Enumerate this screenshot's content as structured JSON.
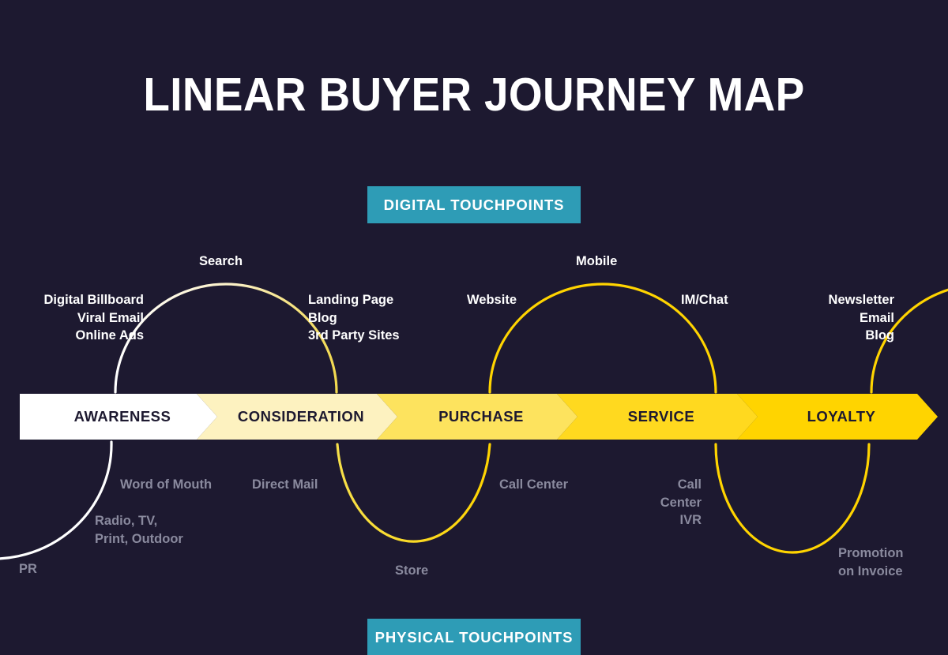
{
  "title": "LINEAR BUYER JOURNEY MAP",
  "colors": {
    "background": "#1d1930",
    "badge": "#2e9cb6",
    "digital_text": "#ffffff",
    "physical_text": "#8a8a9e",
    "arc_white": "#ffffff",
    "arc_cream": "#f6edc0",
    "arc_yellow": "#ffd400",
    "stage_text": "#1d1930"
  },
  "badges": {
    "digital": "DIGITAL TOUCHPOINTS",
    "physical": "PHYSICAL TOUCHPOINTS"
  },
  "stages": [
    {
      "label": "AWARENESS",
      "fill": "#ffffff"
    },
    {
      "label": "CONSIDERATION",
      "fill": "#fdf2c0"
    },
    {
      "label": "PURCHASE",
      "fill": "#fde35e"
    },
    {
      "label": "SERVICE",
      "fill": "#ffd91f"
    },
    {
      "label": "LOYALTY",
      "fill": "#ffd400"
    }
  ],
  "digital_touchpoints": [
    {
      "id": "awareness-digital",
      "text": "Digital Billboard\nViral Email\nOnline Ads",
      "align": "right"
    },
    {
      "id": "search",
      "text": "Search",
      "align": "center"
    },
    {
      "id": "consideration-digital",
      "text": "Landing Page\nBlog\n3rd Party Sites",
      "align": "left"
    },
    {
      "id": "website",
      "text": "Website",
      "align": "right"
    },
    {
      "id": "mobile",
      "text": "Mobile",
      "align": "center"
    },
    {
      "id": "im-chat",
      "text": "IM/Chat",
      "align": "left"
    },
    {
      "id": "loyalty-digital",
      "text": "Newsletter\nEmail\nBlog",
      "align": "right"
    }
  ],
  "physical_touchpoints": [
    {
      "id": "pr",
      "text": "PR",
      "align": "left"
    },
    {
      "id": "radio-tv",
      "text": "Radio, TV,\nPrint, Outdoor",
      "align": "left"
    },
    {
      "id": "word-of-mouth",
      "text": "Word of Mouth",
      "align": "left"
    },
    {
      "id": "direct-mail",
      "text": "Direct Mail",
      "align": "left"
    },
    {
      "id": "store",
      "text": "Store",
      "align": "center"
    },
    {
      "id": "call-center",
      "text": "Call Center",
      "align": "left"
    },
    {
      "id": "call-center-ivr",
      "text": "Call\nCenter\nIVR",
      "align": "right"
    },
    {
      "id": "promotion-on-invoice",
      "text": "Promotion\non Invoice",
      "align": "left"
    }
  ]
}
